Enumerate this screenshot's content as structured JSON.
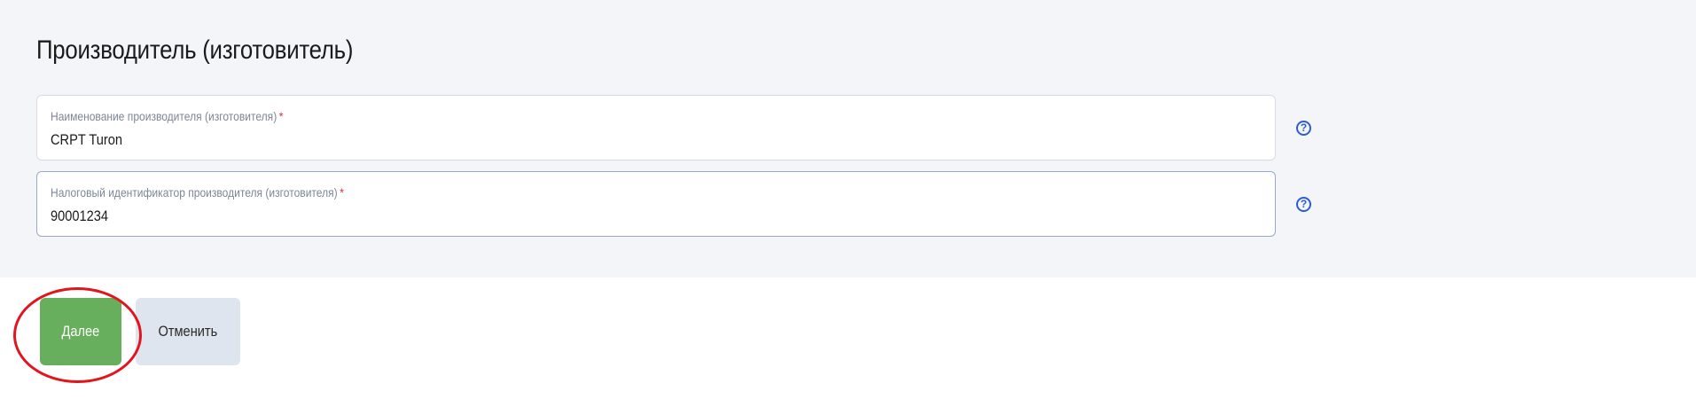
{
  "section": {
    "title": "Производитель (изготовитель)"
  },
  "fields": [
    {
      "label": "Наименование производителя (изготовителя)",
      "required_mark": "*",
      "value": "CRPT Turon"
    },
    {
      "label": "Налоговый идентификатор производителя (изготовителя)",
      "required_mark": "*",
      "value": "90001234"
    }
  ],
  "help_icon": {
    "glyph": "?"
  },
  "actions": {
    "next_label": "Далее",
    "cancel_label": "Отменить"
  },
  "colors": {
    "primary": "#67ae5d",
    "secondary": "#dfe5ee",
    "help": "#2d5dd0",
    "required": "#e2344c",
    "annotation": "#e0151e"
  }
}
